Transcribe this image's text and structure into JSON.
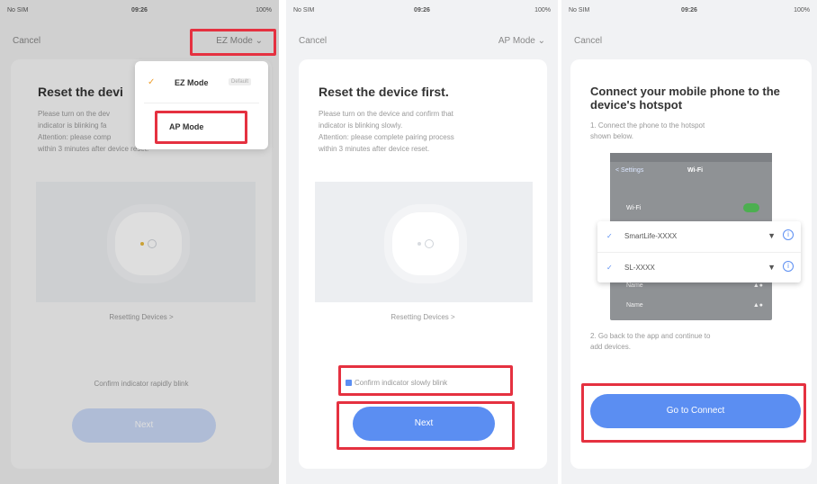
{
  "status": {
    "carrier": "No SIM",
    "time": "09:26",
    "battery": "100%"
  },
  "nav": {
    "cancel": "Cancel",
    "mode_ez": "EZ Mode",
    "mode_ap": "AP Mode"
  },
  "dropdown": {
    "ez_label": "EZ Mode",
    "ez_badge": "Default",
    "ap_label": "AP Mode"
  },
  "screen1": {
    "title": "Reset the devi",
    "desc": [
      "Please turn on the dev",
      "indicator is blinking fa",
      "Attention: please comp",
      "within 3 minutes after device reset."
    ],
    "reset_link": "Resetting Devices >",
    "confirm": "Confirm indicator rapidly blink",
    "next": "Next"
  },
  "screen2": {
    "title": "Reset the device first.",
    "desc": [
      "Please turn on the device and confirm that",
      "indicator is blinking slowly.",
      "Attention: please complete pairing process",
      "within 3 minutes after device reset."
    ],
    "reset_link": "Resetting Devices >",
    "confirm": "Confirm indicator slowly blink",
    "next": "Next"
  },
  "screen3": {
    "title": "Connect your mobile phone to the device's hotspot",
    "step1": [
      "1. Connect the phone to the hotspot",
      "shown below."
    ],
    "phone_back": "< Settings",
    "phone_title": "Wi-Fi",
    "phone_wifi_label": "Wi-Fi",
    "networks": [
      "SmartLife-XXXX",
      "SL-XXXX"
    ],
    "other_rows": [
      "Name",
      "Name"
    ],
    "step2": [
      "2. Go back to the app and continue to",
      "add devices."
    ],
    "connect": "Go to Connect"
  },
  "colors": {
    "accent": "#5b8ef2",
    "highlight": "#e53140",
    "check": "#f0a030"
  }
}
